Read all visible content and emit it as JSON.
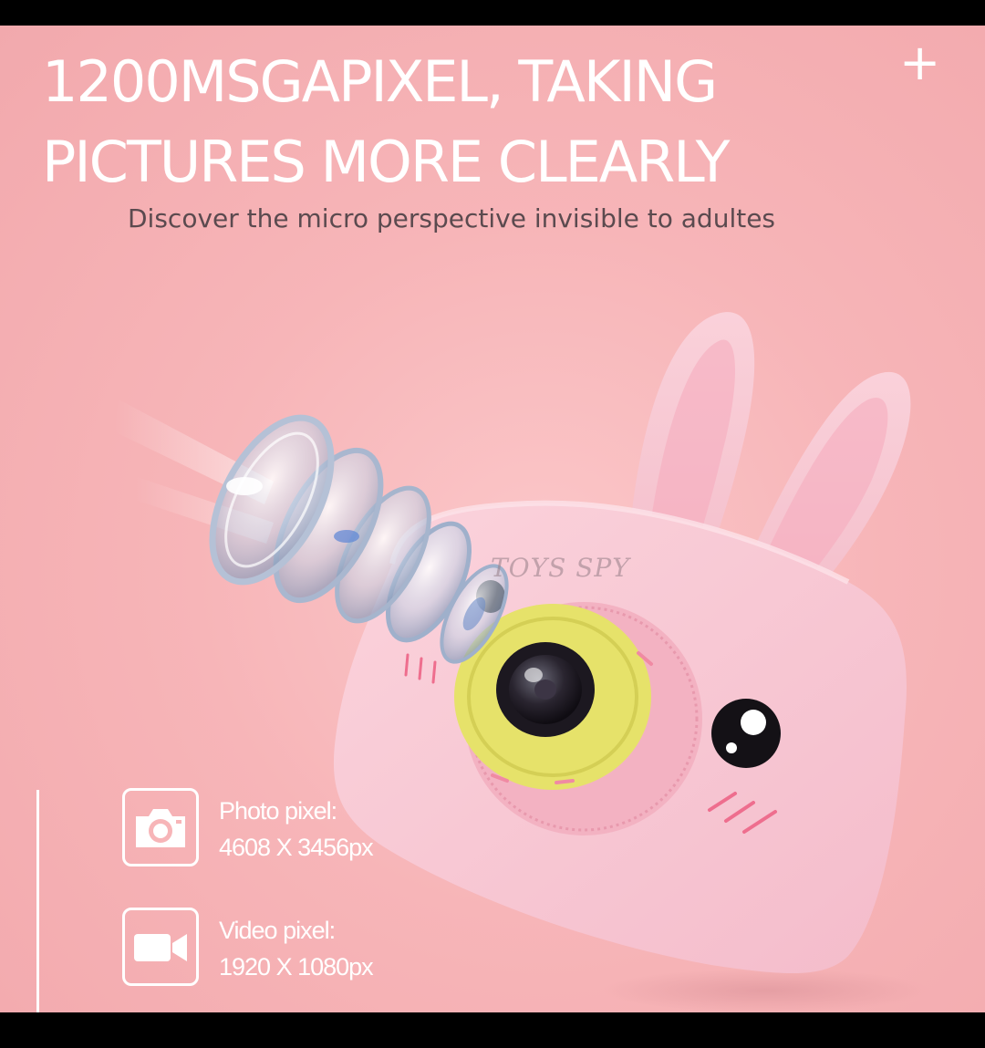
{
  "banner": {
    "headline_line1": "1200MSGAPIXEL, TAKING",
    "headline_line2": "PICTURES MORE CLEARLY",
    "plus_mark": "+",
    "subtitle": "Discover the micro perspective invisible to adultes"
  },
  "specs": [
    {
      "icon": "camera-icon",
      "label": "Photo pixel:",
      "value": "4608 X 3456px"
    },
    {
      "icon": "video-camera-icon",
      "label": "Video pixel:",
      "value": "1920 X 1080px"
    }
  ],
  "watermark": "TOYS SPY",
  "colors": {
    "background_pink": "#f7b5b8",
    "camera_body_pink": "#f9c9d3",
    "lens_ring_yellow": "#e8e36a",
    "text_white": "#ffffff",
    "subtitle_gray": "#5b4a4f"
  }
}
